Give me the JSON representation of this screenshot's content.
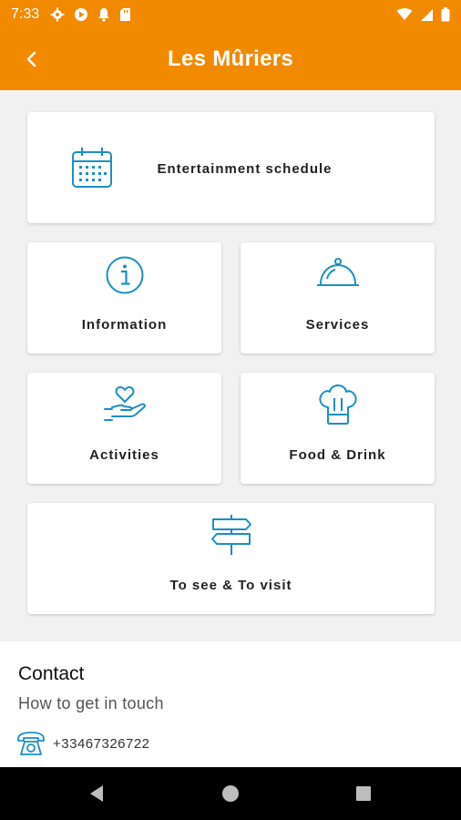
{
  "status_bar": {
    "time": "7:33"
  },
  "app_bar": {
    "title": "Les Mûriers"
  },
  "colors": {
    "accent": "#f28a00",
    "icon": "#1a8fc4"
  },
  "tiles": {
    "entertainment": {
      "label": "Entertainment schedule",
      "icon": "calendar-icon"
    },
    "information": {
      "label": "Information",
      "icon": "info-icon"
    },
    "services": {
      "label": "Services",
      "icon": "service-bell-icon"
    },
    "activities": {
      "label": "Activities",
      "icon": "heart-hand-icon"
    },
    "food": {
      "label": "Food & Drink",
      "icon": "chef-hat-icon"
    },
    "visit": {
      "label": "To see & To visit",
      "icon": "signpost-icon"
    }
  },
  "contact": {
    "title": "Contact",
    "subtitle": "How to get in touch",
    "phone": "+33467326722"
  }
}
